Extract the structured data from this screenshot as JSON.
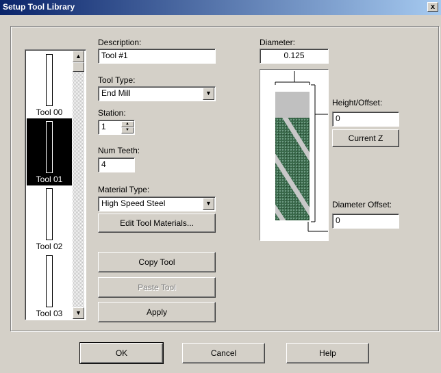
{
  "window": {
    "title": "Setup Tool Library",
    "close": "x"
  },
  "tools": [
    {
      "name": "Tool 00",
      "selected": false
    },
    {
      "name": "Tool 01",
      "selected": true
    },
    {
      "name": "Tool 02",
      "selected": false
    },
    {
      "name": "Tool 03",
      "selected": false
    }
  ],
  "form": {
    "description_label": "Description:",
    "description_value": "Tool #1",
    "tool_type_label": "Tool Type:",
    "tool_type_value": "End Mill",
    "station_label": "Station:",
    "station_value": "1",
    "num_teeth_label": "Num Teeth:",
    "num_teeth_value": "4",
    "material_label": "Material Type:",
    "material_value": "High Speed Steel",
    "edit_materials_button": "Edit Tool Materials...",
    "copy_button": "Copy Tool",
    "paste_button": "Paste Tool",
    "apply_button": "Apply"
  },
  "geometry": {
    "diameter_label": "Diameter:",
    "diameter_value": "0.125",
    "height_offset_label": "Height/Offset:",
    "height_offset_value": "0",
    "current_z_button": "Current Z",
    "diameter_offset_label": "Diameter Offset:",
    "diameter_offset_value": "0"
  },
  "footer": {
    "ok": "OK",
    "cancel": "Cancel",
    "help": "Help"
  }
}
